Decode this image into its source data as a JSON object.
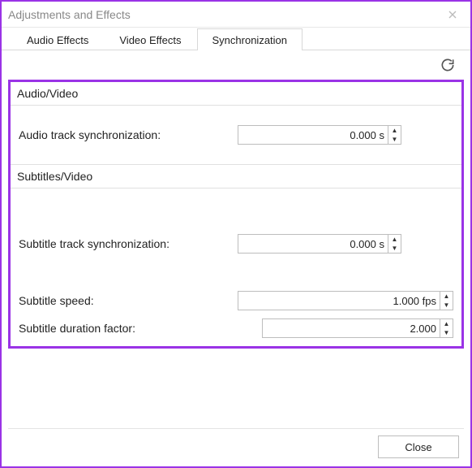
{
  "window": {
    "title": "Adjustments and Effects"
  },
  "tabs": {
    "audio": "Audio Effects",
    "video": "Video Effects",
    "sync": "Synchronization"
  },
  "groups": {
    "av": "Audio/Video",
    "subs": "Subtitles/Video"
  },
  "fields": {
    "audioSync": {
      "label": "Audio track synchronization:",
      "value": "0.000 s"
    },
    "subSync": {
      "label": "Subtitle track synchronization:",
      "value": "0.000 s"
    },
    "subSpeed": {
      "label": "Subtitle speed:",
      "value": "1.000 fps"
    },
    "subDur": {
      "label": "Subtitle duration factor:",
      "value": "2.000"
    }
  },
  "footer": {
    "close": "Close"
  }
}
